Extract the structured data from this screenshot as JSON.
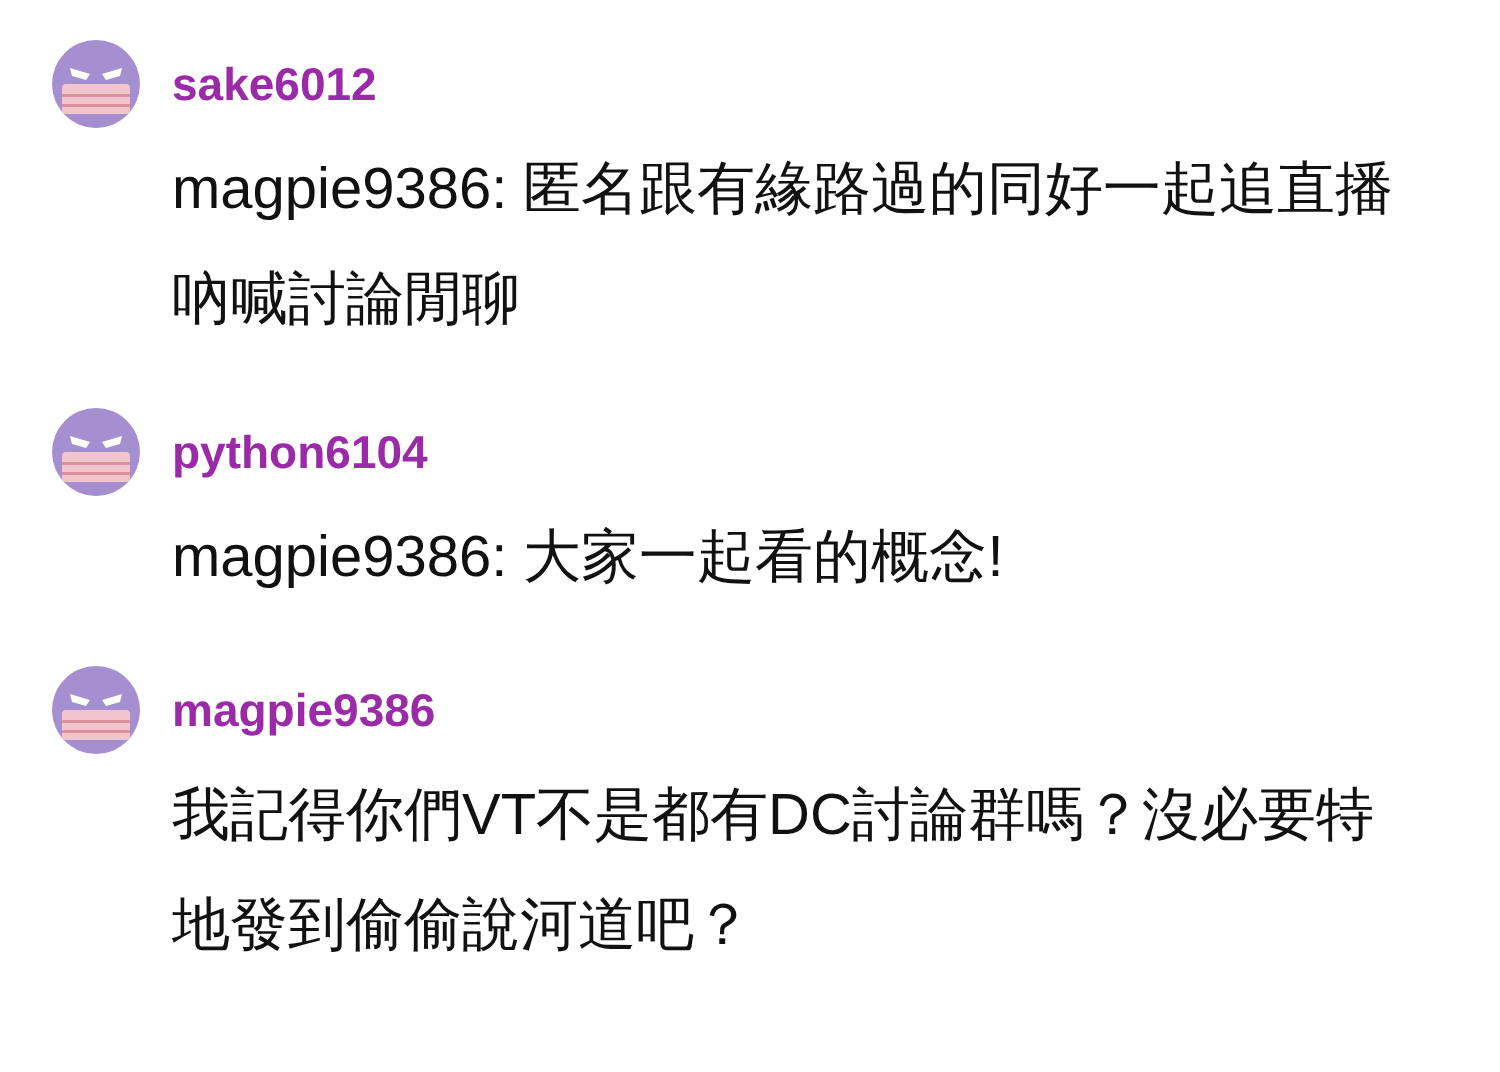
{
  "messages": [
    {
      "username": "sake6012",
      "text": "magpie9386: 匿名跟有緣路過的同好一起追直播吶喊討論閒聊"
    },
    {
      "username": "python6104",
      "text": "magpie9386: 大家一起看的概念!"
    },
    {
      "username": "magpie9386",
      "text": "我記得你們VT不是都有DC討論群嗎？沒必要特地發到偷偷說河道吧？"
    }
  ]
}
